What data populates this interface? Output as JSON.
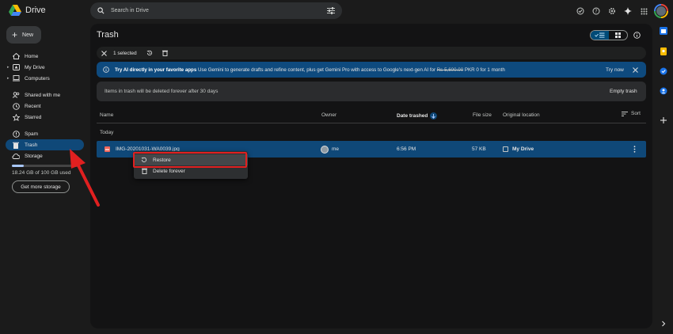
{
  "app": {
    "name": "Drive",
    "logo_icon": "drive-logo-icon"
  },
  "search": {
    "placeholder": "Search in Drive"
  },
  "left_nav": {
    "new_label": "New",
    "items": [
      {
        "label": "Home",
        "icon": "home-icon"
      },
      {
        "label": "My Drive",
        "icon": "my-drive-icon"
      },
      {
        "label": "Computers",
        "icon": "computers-icon"
      },
      {
        "label": "Shared with me",
        "icon": "shared-icon"
      },
      {
        "label": "Recent",
        "icon": "clock-icon"
      },
      {
        "label": "Starred",
        "icon": "star-icon"
      },
      {
        "label": "Spam",
        "icon": "spam-icon"
      },
      {
        "label": "Trash",
        "icon": "trash-icon"
      },
      {
        "label": "Storage",
        "icon": "cloud-icon"
      }
    ],
    "storage_used_fraction": 0.1824,
    "storage_text": "18.24 GB of 100 GB used",
    "get_storage_label": "Get more storage"
  },
  "main": {
    "title": "Trash",
    "selection_count": "1 selected",
    "banner": {
      "lead": "Try AI directly in your favorite apps",
      "body": " Use Gemini to generate drafts and refine content, plus get Gemini Pro with access to Google's next-gen AI for ",
      "old_price": "Rs 5,600.00",
      "new_price": " PKR 0 for 1 month",
      "try_now": "Try now"
    },
    "notice": {
      "text": "Items in trash will be deleted forever after 30 days",
      "empty_trash": "Empty trash"
    },
    "columns": {
      "name": "Name",
      "owner": "Owner",
      "date_trashed": "Date trashed",
      "file_size": "File size",
      "original_location": "Original location",
      "sort": "Sort"
    },
    "group_label": "Today",
    "file": {
      "name": "IMG-20201031-WA0039.jpg",
      "owner": "me",
      "date_trashed": "6:56 PM",
      "file_size": "57 KB",
      "location": "My Drive"
    }
  },
  "context_menu": {
    "restore": "Restore",
    "delete_forever": "Delete forever"
  },
  "colors": {
    "selection_blue": "#0f4878",
    "banner_blue": "#0e4a7e",
    "annotation_red": "#e02020"
  }
}
